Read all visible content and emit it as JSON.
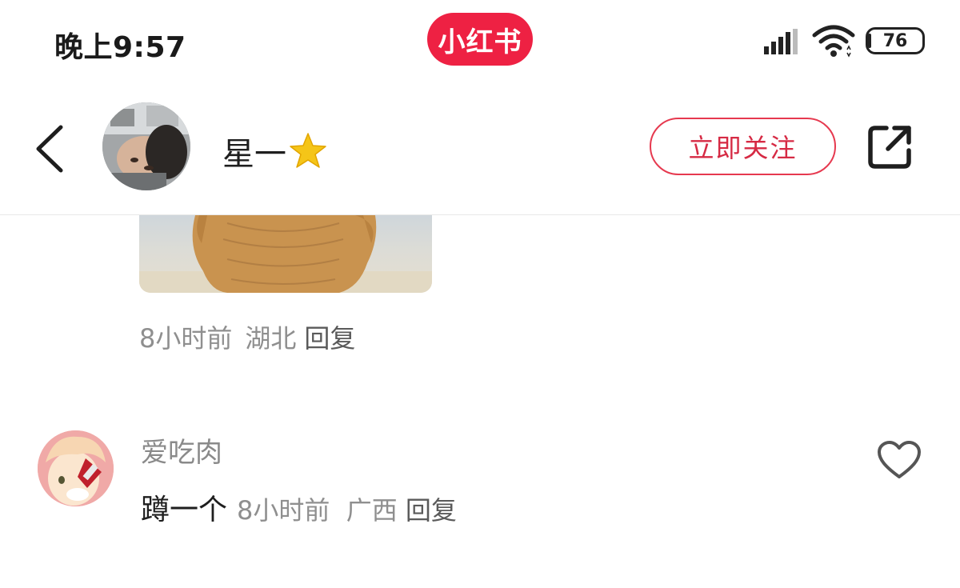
{
  "status_bar": {
    "time": "晚上9:57",
    "app_name": "小红书",
    "battery": "76",
    "icons": [
      "signal-icon",
      "wifi-icon",
      "battery-icon"
    ]
  },
  "header": {
    "author_name": "星一",
    "author_emoji": "star-icon",
    "follow_label": "立即关注",
    "icons": [
      "back-icon",
      "share-icon"
    ]
  },
  "comments": [
    {
      "time": "8小时前",
      "location": "湖北",
      "reply_label": "回复",
      "has_image": true
    },
    {
      "username": "爱吃肉",
      "text": "蹲一个",
      "time": "8小时前",
      "location": "广西",
      "reply_label": "回复",
      "like_icon": "heart-icon"
    }
  ],
  "colors": {
    "accent": "#ee2143",
    "follow_border": "#e6394f",
    "meta_text": "#8f8f8f"
  }
}
